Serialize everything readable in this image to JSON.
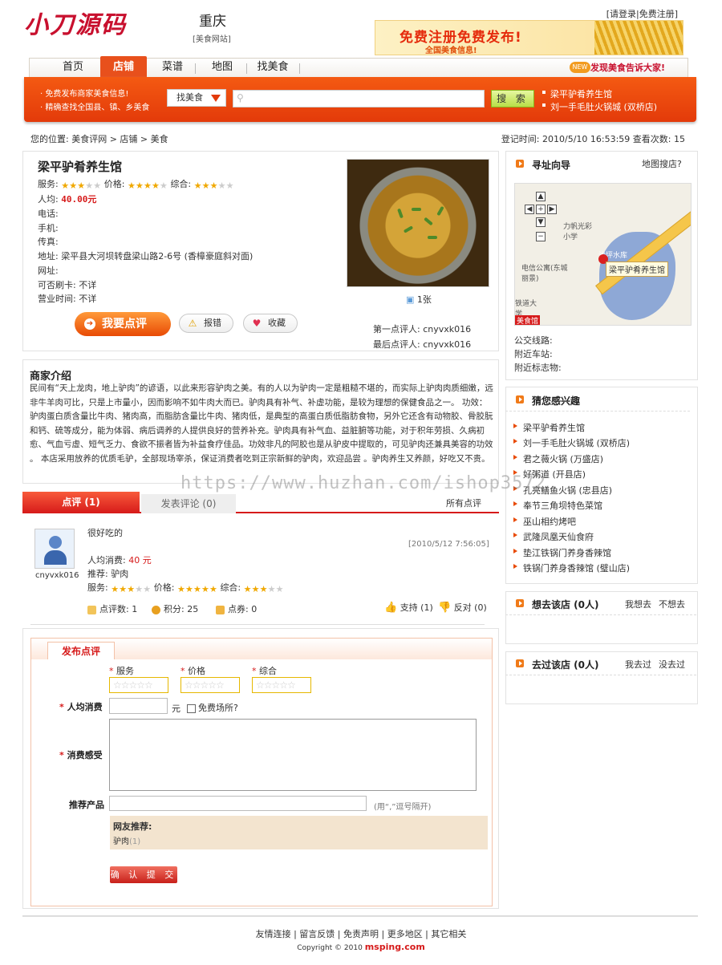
{
  "header": {
    "logo": "小刀源码",
    "city": "重庆",
    "site": "[美食网站]",
    "login_links": "[请登录|免费注册]",
    "banner_main": "免费注册免费发布!",
    "banner_sub": "全国美食信息!"
  },
  "nav": {
    "tabs": [
      "首页",
      "店铺",
      "菜谱",
      "地图",
      "找美食"
    ],
    "active": "店铺",
    "new_badge": "NEW",
    "tagline": "发现美食告诉大家!"
  },
  "search": {
    "tip1": "· 免费发布商家美食信息!",
    "tip2": "· 精确查找全国县、镇、乡美食",
    "select_value": "找美食",
    "button": "搜 索",
    "hot1": "梁平驴肴养生馆",
    "hot2": "刘一手毛肚火锅城 (双桥店)"
  },
  "breadcrumb": "您的位置: 美食评网 > 店铺 > 美食",
  "reg_info": "登记时间: 2010/5/10 16:53:59   查看次数: 15",
  "shop": {
    "name": "梁平驴肴养生馆",
    "service_label": "服务:",
    "price_label": "价格:",
    "overall_label": "综合:",
    "ratings": {
      "service": 3,
      "price": 4,
      "overall": 3,
      "max": 5
    },
    "avg_label": "人均:",
    "avg_value": "40.00元",
    "phone": "电话:",
    "mobile": "手机:",
    "fax": "传真:",
    "address": "地址: 梁平县大河坝转盘梁山路2-6号 (香樟豪庭斜对面)",
    "website": "网址:",
    "card": "可否刷卡: 不详",
    "hours": "营业时间: 不详",
    "review_button": "我要点评",
    "report_button": "报错",
    "fav_button": "收藏",
    "photo_count": "1张",
    "first_reviewer": "第一点评人: cnyvxk016",
    "last_reviewer": "最后点评人: cnyvxk016"
  },
  "intro": {
    "title": "商家介绍",
    "text": "民间有“天上龙肉，地上驴肉”的谚语，以此来形容驴肉之美。有的人以为驴肉一定是粗糙不堪的，而实际上驴肉肉质细嫩，远非牛羊肉可比，只是上市量小，因而影响不如牛肉大而已。驴肉具有补气、补虚功能，是较为理想的保健食品之一。 功效： 驴肉蛋白质含量比牛肉、猪肉高，而脂肪含量比牛肉、猪肉低，是典型的高蛋白质低脂肪食物，另外它还含有动物胶、骨胶朊和钙、硫等成分，能为体弱、病后调养的人提供良好的营养补充。驴肉具有补气血、益脏腑等功能，对于积年劳损、久病初愈、气血亏虚、短气乏力、食欲不振者皆为补益食疗佳品。功效非凡的阿胶也是从驴皮中提取的，可见驴肉还兼具美容的功效 。 本店采用放养的优质毛驴，全部现场宰杀，保证消费者吃到正宗新鲜的驴肉，欢迎品尝 。驴肉养生又养颜，好吃又不贵。"
  },
  "comments": {
    "tab_reviews": "点评 (1)",
    "tab_post": "发表评论 (0)",
    "all_link": "所有点评",
    "item": {
      "user": "cnyvxk016",
      "title": "很好吃的",
      "time": "[2010/5/12 7:56:05]",
      "spend_label": "人均消费:",
      "spend_value": "40 元",
      "recommend": "推荐: 驴肉",
      "service_label": "服务:",
      "price_label": "价格:",
      "overall_label": "综合:",
      "ratings": {
        "service": 3,
        "price": 5,
        "overall": 3
      },
      "count": "点评数: 1",
      "points": "积分: 25",
      "coupons": "点券: 0",
      "support": "支持 (1)",
      "oppose": "反对 (0)"
    }
  },
  "publish": {
    "tab": "发布点评",
    "service": "服务",
    "price": "价格",
    "overall": "综合",
    "star_placeholder": "☆☆☆☆☆",
    "spend_label": "人均消费",
    "yuan": "元",
    "free_label": "免费场所?",
    "feeling_label": "消费感受",
    "product_label": "推荐产品",
    "product_hint": "(用“,”逗号隔开)",
    "friend_title": "网友推荐:",
    "friend_item": "驴肉",
    "friend_count": "(1)",
    "submit": "确 认 提 交"
  },
  "sidebar": {
    "guide_title": "寻址向导",
    "map_link": "地图搜店?",
    "map_label": "梁平驴肴养生馆",
    "map_places": [
      "力帆光彩小学",
      "电信公寓(东城丽景)",
      "铁道大学",
      "沙坪水库",
      "美食馆"
    ],
    "bus": "公交线路:",
    "station": "附近车站:",
    "landmark": "附近标志物:",
    "interest_title": "猜您感兴趣",
    "interest": [
      "梁平驴肴养生馆",
      "刘一手毛肚火锅城 (双桥店)",
      "君之薇火锅 (万盛店)",
      "好粥道 (开县店)",
      "孔亮鳝鱼火锅 (忠县店)",
      "奉节三角坝特色菜馆",
      "巫山相约烤吧",
      "武隆凤凰天仙食府",
      "垫江铁锅门养身香辣馆",
      "铁锅门养身香辣馆 (璧山店)"
    ],
    "want_title": "想去该店 (0人)",
    "want_yes": "我想去",
    "want_no": "不想去",
    "been_title": "去过该店 (0人)",
    "been_yes": "我去过",
    "been_no": "没去过"
  },
  "footer": {
    "links": "友情连接 | 留言反馈 | 免责声明 | 更多地区 | 其它相关",
    "copyright": "Copyright © 2010",
    "brand": "msping.com"
  },
  "watermark": "https://www.huzhan.com/ishop3572",
  "colors": {
    "accent": "#e84a05",
    "red": "#d61a1a",
    "star": "#f0a800"
  }
}
